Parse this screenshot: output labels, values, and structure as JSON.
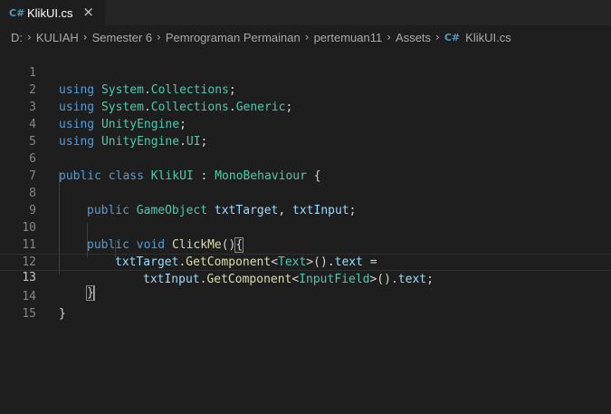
{
  "tab": {
    "icon": "C#",
    "label": "KlikUI.cs",
    "close": "×"
  },
  "breadcrumb": {
    "items": [
      "D:",
      "KULIAH",
      "Semester 6",
      "Pemrograman Permainan",
      "pertemuan11",
      "Assets"
    ],
    "file_icon": "C#",
    "file": "KlikUI.cs",
    "separator": "›"
  },
  "editor": {
    "line_numbers": [
      "1",
      "2",
      "3",
      "4",
      "5",
      "6",
      "7",
      "8",
      "9",
      "10",
      "11",
      "12",
      "13",
      "14",
      "15"
    ],
    "active_line": "13",
    "lines": {
      "l1": {
        "a": "using",
        "b": " ",
        "c": "System",
        "d": ".",
        "e": "Collections",
        "f": ";"
      },
      "l2": {
        "a": "using",
        "b": " ",
        "c": "System",
        "d": ".",
        "e": "Collections",
        "f": ".",
        "g": "Generic",
        "h": ";"
      },
      "l3": {
        "a": "using",
        "b": " ",
        "c": "UnityEngine",
        "d": ";"
      },
      "l4": {
        "a": "using",
        "b": " ",
        "c": "UnityEngine",
        "d": ".",
        "e": "UI",
        "f": ";"
      },
      "l6": {
        "a": "public",
        "b": " ",
        "c": "class",
        "d": " ",
        "e": "KlikUI",
        "f": " : ",
        "g": "MonoBehaviour",
        "h": " {"
      },
      "l8": {
        "a": "public",
        "b": " ",
        "c": "GameObject",
        "d": " ",
        "e": "txtTarget",
        "f": ", ",
        "g": "txtInput",
        "h": ";"
      },
      "l10": {
        "a": "public",
        "b": " ",
        "c": "void",
        "d": " ",
        "e": "ClickMe",
        "f": "()",
        "g": "{"
      },
      "l11": {
        "a": "txtTarget",
        "b": ".",
        "c": "GetComponent",
        "d": "<",
        "e": "Text",
        "f": ">().",
        "g": "text",
        "h": " ="
      },
      "l12": {
        "a": "txtInput",
        "b": ".",
        "c": "GetComponent",
        "d": "<",
        "e": "InputField",
        "f": ">().",
        "g": "text",
        "h": ";"
      },
      "l13": {
        "a": "}"
      },
      "l14": {
        "a": "}"
      }
    }
  },
  "colors": {
    "background": "#1e1e1e",
    "keyword": "#569cd6",
    "type": "#4ec9b0",
    "identifier": "#9cdcfe",
    "function": "#dcdcaa",
    "plain": "#d4d4d4",
    "line_number": "#858585"
  }
}
